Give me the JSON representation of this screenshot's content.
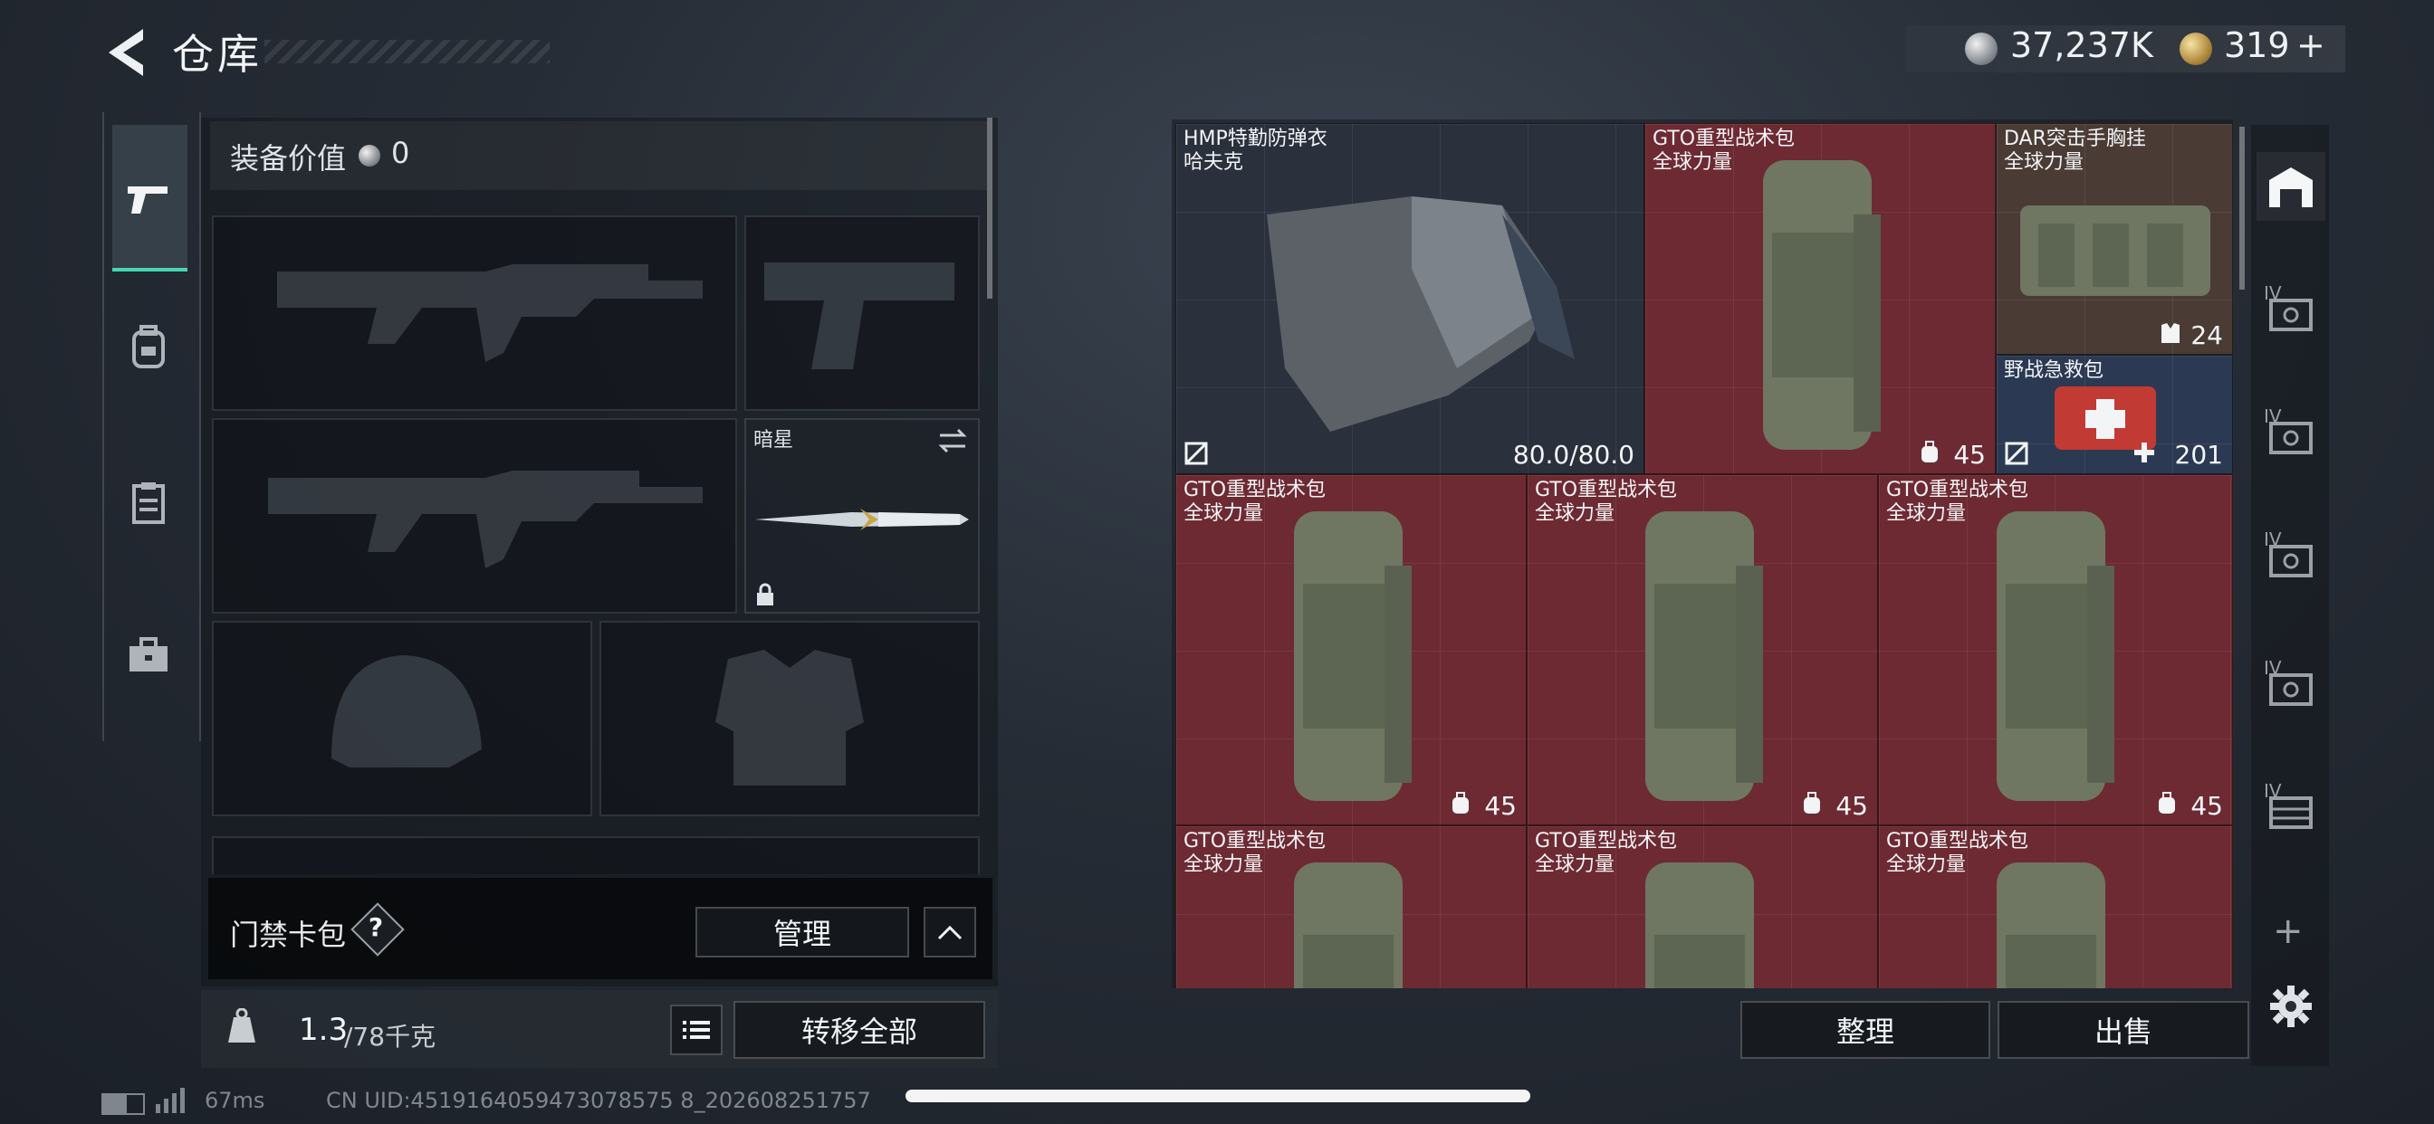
{
  "header": {
    "title": "仓库",
    "silver_amount": "37,237K",
    "gold_amount": "319",
    "gold_plus": "+"
  },
  "left_tabs": [
    "firearm-tab",
    "backpack-tab",
    "clipboard-tab",
    "briefcase-tab"
  ],
  "loadout": {
    "value_label": "装备价值",
    "value": "0",
    "melee_name": "暗星",
    "card_label": "门禁卡包",
    "help": "?",
    "manage_button": "管理",
    "weight_current": "1.3",
    "weight_max": "/78千克",
    "transfer_all_button": "转移全部"
  },
  "inventory": {
    "items": [
      {
        "name": "HMP特勤防弹衣",
        "sub": "哈夫克",
        "value": "80.0/80.0",
        "icon": "no-insure-icon",
        "bg": "dark"
      },
      {
        "name": "GTO重型战术包",
        "sub": "全球力量",
        "value": "45",
        "icon": "backpack-icon",
        "bg": "red"
      },
      {
        "name": "DAR突击手胸挂",
        "sub": "全球力量",
        "value": "24",
        "icon": "vest-icon",
        "bg": "brown"
      },
      {
        "name": "野战急救包",
        "sub": "",
        "value": "201",
        "icon": "medkit-plus-icon",
        "bg": "blue"
      },
      {
        "name": "GTO重型战术包",
        "sub": "全球力量",
        "value": "45",
        "icon": "backpack-icon",
        "bg": "red"
      },
      {
        "name": "GTO重型战术包",
        "sub": "全球力量",
        "value": "45",
        "icon": "backpack-icon",
        "bg": "red"
      },
      {
        "name": "GTO重型战术包",
        "sub": "全球力量",
        "value": "45",
        "icon": "backpack-icon",
        "bg": "red"
      },
      {
        "name": "GTO重型战术包",
        "sub": "全球力量",
        "value": "",
        "icon": "",
        "bg": "red"
      },
      {
        "name": "GTO重型战术包",
        "sub": "全球力量",
        "value": "",
        "icon": "",
        "bg": "red"
      },
      {
        "name": "GTO重型战术包",
        "sub": "全球力量",
        "value": "",
        "icon": "",
        "bg": "red"
      }
    ],
    "sort_button": "整理",
    "sell_button": "出售"
  },
  "side_tabs": {
    "level_badge": "IV",
    "add": "+"
  },
  "status_bar": {
    "ping": "67ms",
    "uid": "CN UID:4519164059473078575 8_202608251757"
  },
  "colors": {
    "accent": "#47d7b0",
    "red_cell": "#6d2a33"
  }
}
